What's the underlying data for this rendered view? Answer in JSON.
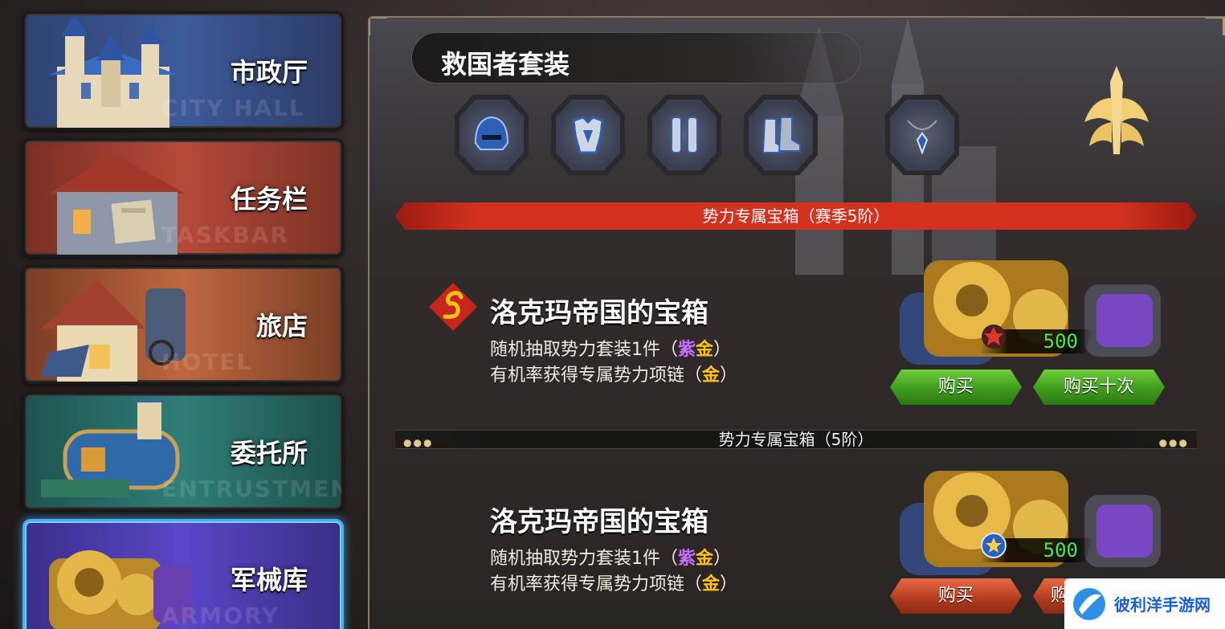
{
  "sidebar": {
    "items": [
      {
        "label": "市政厅",
        "sub": "CITY HALL"
      },
      {
        "label": "任务栏",
        "sub": "TASKBAR"
      },
      {
        "label": "旅店",
        "sub": "HOTEL"
      },
      {
        "label": "委托所",
        "sub": "ENTRUSTMENT"
      },
      {
        "label": "军械库",
        "sub": "ARMORY"
      }
    ],
    "active_index": 4
  },
  "set": {
    "title": "救国者套装",
    "items": [
      "helmet-icon",
      "armor-icon",
      "greaves-icon",
      "boots-icon",
      "necklace-icon"
    ]
  },
  "sections": [
    {
      "banner": "势力专属宝箱（赛季5阶）",
      "box": {
        "title": "洛克玛帝国的宝箱",
        "line1_pre": "随机抽取势力套装1件（",
        "line1_purple": "紫",
        "line1_gold": "金",
        "line1_post": "）",
        "line2_pre": "有机率获得专属势力项链（",
        "line2_gold": "金",
        "line2_post": "）",
        "price": "500",
        "buy": "购买",
        "buy_ten": "购买十次"
      }
    },
    {
      "banner": "势力专属宝箱（5阶）",
      "box": {
        "title": "洛克玛帝国的宝箱",
        "line1_pre": "随机抽取势力套装1件（",
        "line1_purple": "紫",
        "line1_gold": "金",
        "line1_post": "）",
        "line2_pre": "有机率获得专属势力项链（",
        "line2_gold": "金",
        "line2_post": "）",
        "price": "500",
        "buy": "购买",
        "buy_ten": "购"
      }
    }
  ],
  "watermark": "彼利洋手游网",
  "colors": {
    "accent_red": "#d3321f",
    "price_green": "#4ee84e",
    "purple_text": "#c76cff",
    "gold_text": "#ffc21a",
    "active_border": "#3fb1ff"
  }
}
